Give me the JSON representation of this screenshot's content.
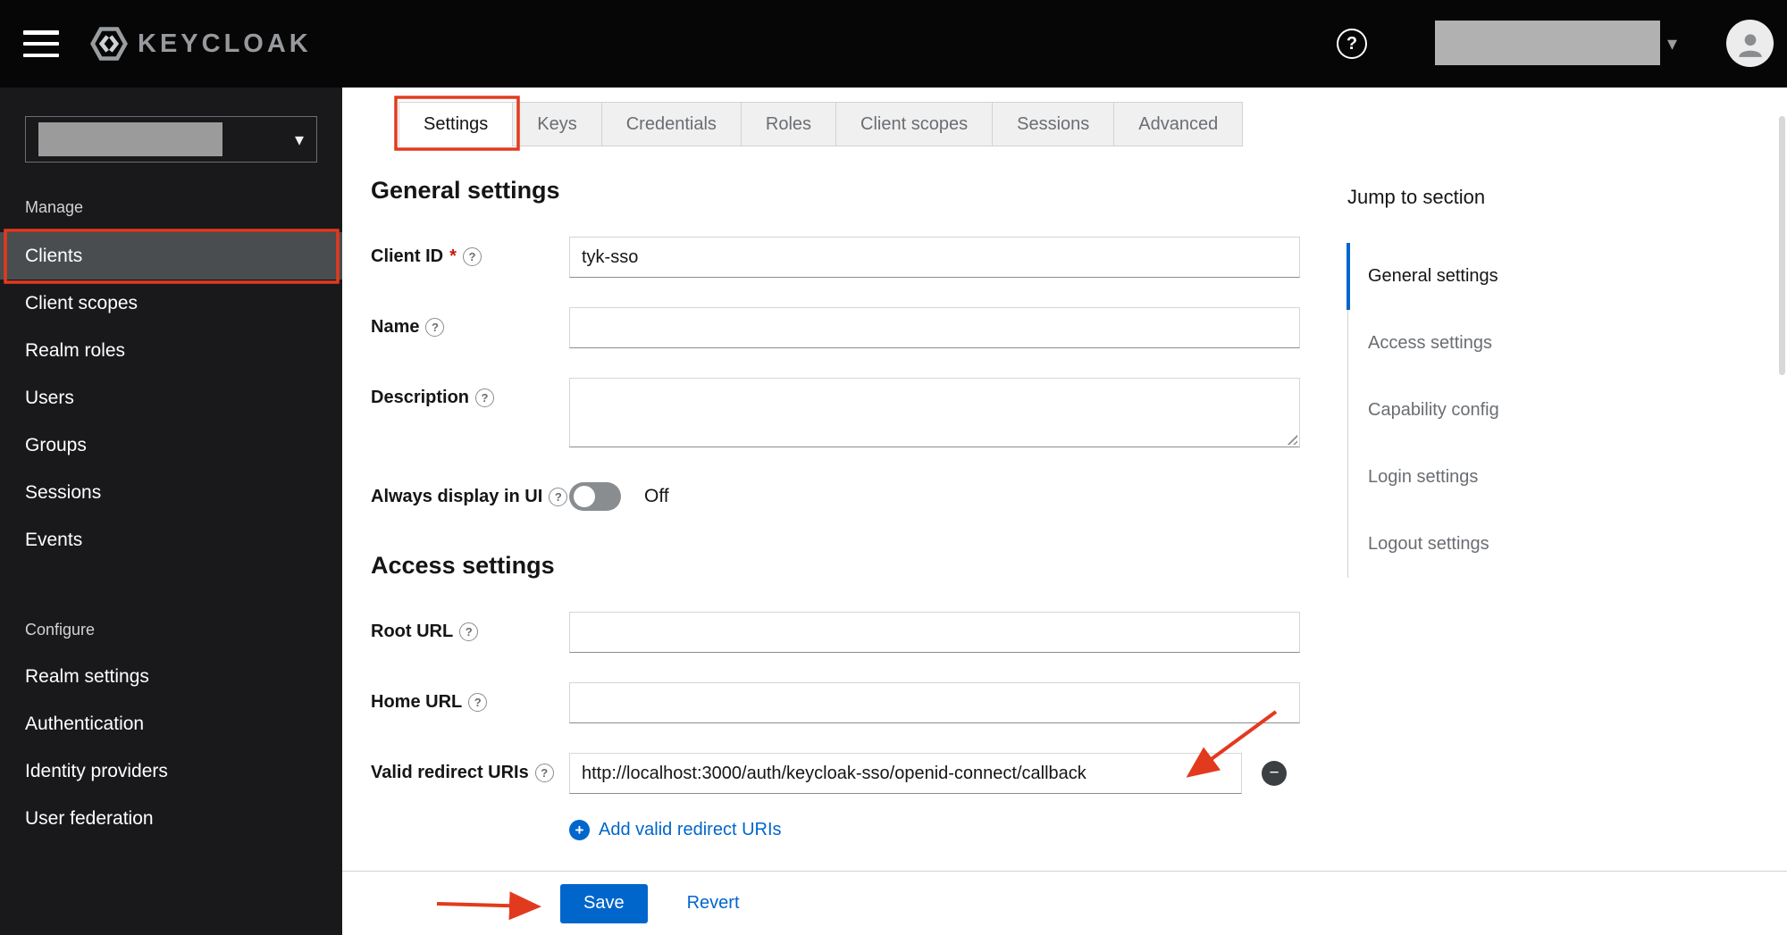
{
  "header": {
    "brand": "KEYCLOAK"
  },
  "icons": {
    "help": "?",
    "plus": "+",
    "minus": "−",
    "caret": "▾"
  },
  "sidebar": {
    "sections": [
      {
        "label": "Manage",
        "items": [
          "Clients",
          "Client scopes",
          "Realm roles",
          "Users",
          "Groups",
          "Sessions",
          "Events"
        ]
      },
      {
        "label": "Configure",
        "items": [
          "Realm settings",
          "Authentication",
          "Identity providers",
          "User federation"
        ]
      }
    ],
    "selected_item": "Clients"
  },
  "tabs": {
    "items": [
      "Settings",
      "Keys",
      "Credentials",
      "Roles",
      "Client scopes",
      "Sessions",
      "Advanced"
    ],
    "selected": "Settings"
  },
  "form": {
    "general_heading": "General settings",
    "client_id": {
      "label": "Client ID",
      "required": "*",
      "value": "tyk-sso"
    },
    "name": {
      "label": "Name",
      "value": ""
    },
    "description": {
      "label": "Description",
      "value": ""
    },
    "always_display": {
      "label": "Always display in UI",
      "state": "Off"
    },
    "access_heading": "Access settings",
    "root_url": {
      "label": "Root URL",
      "value": ""
    },
    "home_url": {
      "label": "Home URL",
      "value": ""
    },
    "redirect": {
      "label": "Valid redirect URIs",
      "value": "http://localhost:3000/auth/keycloak-sso/openid-connect/callback"
    },
    "add_redirect_label": "Add valid redirect URIs"
  },
  "jump": {
    "title": "Jump to section",
    "items": [
      "General settings",
      "Access settings",
      "Capability config",
      "Login settings",
      "Logout settings"
    ],
    "active": "General settings"
  },
  "actions": {
    "save": "Save",
    "revert": "Revert"
  },
  "colors": {
    "accent": "#0066cc",
    "annotation": "#e23a1e",
    "link": "#0066cc"
  }
}
